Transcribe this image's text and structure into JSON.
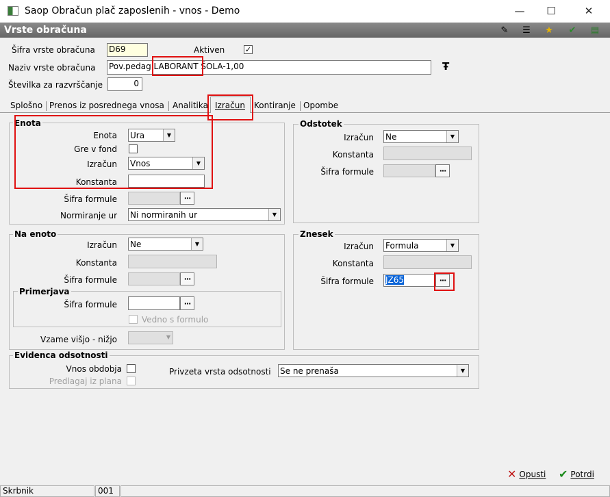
{
  "window": {
    "title": "Saop Obračun plač zaposlenih - vnos - Demo",
    "minimize": "—",
    "maximize": "☐",
    "close": "✕"
  },
  "header": {
    "title": "Vrste obračuna",
    "toolbar_icons": [
      "edit-icon",
      "list-icon",
      "star-icon",
      "doc-check-icon",
      "books-icon"
    ]
  },
  "form": {
    "sifra_label": "Šifra vrste obračuna",
    "sifra_value": "D69",
    "aktiven_label": "Aktiven",
    "aktiven_checked": "✓",
    "naziv_label": "Naziv vrste obračuna",
    "naziv_value": "Pov.pedag.LABORANT ŠOLA-1,00",
    "stevilka_label": "Številka  za razvrščanje",
    "stevilka_value": "0",
    "font_icon": "Ŧ"
  },
  "tabs": [
    "Splošno",
    "Prenos iz posrednega vnosa",
    "Analitika",
    "Izračun",
    "Kontiranje",
    "Opombe"
  ],
  "active_tab": "Izračun",
  "enota": {
    "title": "Enota",
    "enota_label": "Enota",
    "enota_value": "Ura",
    "gre_label": "Gre v fond",
    "izracun_label": "Izračun",
    "izracun_value": "Vnos",
    "konstanta_label": "Konstanta",
    "konstanta_value": "",
    "sifra_label": "Šifra formule",
    "normiranje_label": "Normiranje ur",
    "normiranje_value": "Ni normiranih ur"
  },
  "na_enoto": {
    "title": "Na enoto",
    "izracun_label": "Izračun",
    "izracun_value": "Ne",
    "konstanta_label": "Konstanta",
    "sifra_label": "Šifra formule",
    "primerjava_title": "Primerjava",
    "primerjava_sifra_label": "Šifra formule",
    "vedno_label": "Vedno s formulo",
    "vzame_label": "Vzame višjo - nižjo"
  },
  "odstotek": {
    "title": "Odstotek",
    "izracun_label": "Izračun",
    "izracun_value": "Ne",
    "konstanta_label": "Konstanta",
    "sifra_label": "Šifra formule"
  },
  "znesek": {
    "title": "Znesek",
    "izracun_label": "Izračun",
    "izracun_value": "Formula",
    "konstanta_label": "Konstanta",
    "sifra_label": "Šifra formule",
    "sifra_value": "JZ65"
  },
  "evidenca": {
    "title": "Evidenca odsotnosti",
    "vnos_label": "Vnos obdobja",
    "predlagaj_label": "Predlagaj iz plana",
    "privzeta_label": "Privzeta vrsta odsotnosti",
    "privzeta_value": "Se ne prenaša"
  },
  "buttons": {
    "opusti": "Opusti",
    "potrdi": "Potrdi"
  },
  "status": {
    "user": "Skrbnik",
    "code": "001"
  },
  "colors": {
    "annotation": "#e01010",
    "header": "#777777",
    "selection": "#0a64d8"
  }
}
